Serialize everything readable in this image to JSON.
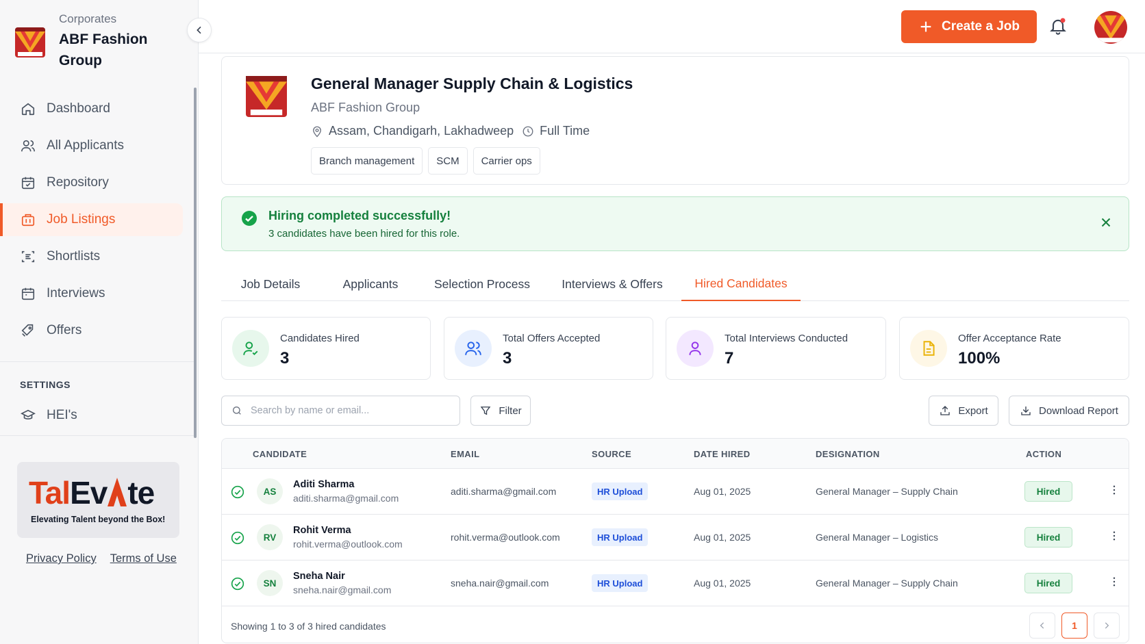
{
  "sidebar": {
    "org_type": "Corporates",
    "org_name": "ABF Fashion Group",
    "nav": [
      {
        "label": "Dashboard",
        "icon": "home-icon"
      },
      {
        "label": "All Applicants",
        "icon": "users-icon"
      },
      {
        "label": "Repository",
        "icon": "calendar-check-icon"
      },
      {
        "label": "Job Listings",
        "icon": "briefcase-icon",
        "active": true
      },
      {
        "label": "Shortlists",
        "icon": "scan-list-icon"
      },
      {
        "label": "Interviews",
        "icon": "calendar-icon"
      },
      {
        "label": "Offers",
        "icon": "tag-icon"
      }
    ],
    "settings_label": "SETTINGS",
    "hei_label": "HEI's",
    "brand": {
      "word_a": "Tal",
      "word_b": "Ev",
      "word_c": "te",
      "tagline": "Elevating Talent beyond the Box!"
    },
    "footer": {
      "privacy": "Privacy Policy",
      "terms": "Terms of Use"
    }
  },
  "topbar": {
    "create_label": "Create a Job"
  },
  "job": {
    "title": "General Manager Supply Chain & Logistics",
    "company": "ABF Fashion Group",
    "locations": "Assam, Chandigarh, Lakhadweep",
    "type": "Full Time",
    "tags": [
      "Branch management",
      "SCM",
      "Carrier ops"
    ]
  },
  "banner": {
    "title": "Hiring completed successfully!",
    "subtitle": "3 candidates have been hired for this role."
  },
  "tabs": [
    "Job Details",
    "Applicants",
    "Selection Process",
    "Interviews & Offers",
    "Hired Candidates"
  ],
  "stats": [
    {
      "label": "Candidates Hired",
      "value": "3"
    },
    {
      "label": "Total Offers Accepted",
      "value": "3"
    },
    {
      "label": "Total Interviews Conducted",
      "value": "7"
    },
    {
      "label": "Offer Acceptance Rate",
      "value": "100%"
    }
  ],
  "toolbar": {
    "search_placeholder": "Search by name or email...",
    "filter_label": "Filter",
    "export_label": "Export",
    "download_label": "Download Report"
  },
  "table": {
    "headers": [
      "CANDIDATE",
      "EMAIL",
      "SOURCE",
      "DATE HIRED",
      "DESIGNATION",
      "ACTION"
    ],
    "rows": [
      {
        "initials": "AS",
        "name": "Aditi Sharma",
        "sub": "aditi.sharma@gmail.com",
        "email": "aditi.sharma@gmail.com",
        "source": "HR Upload",
        "date": "Aug 01, 2025",
        "designation": "General Manager – Supply Chain",
        "status": "Hired"
      },
      {
        "initials": "RV",
        "name": "Rohit Verma",
        "sub": "rohit.verma@outlook.com",
        "email": "rohit.verma@outlook.com",
        "source": "HR Upload",
        "date": "Aug 01, 2025",
        "designation": "General Manager – Logistics",
        "status": "Hired"
      },
      {
        "initials": "SN",
        "name": "Sneha Nair",
        "sub": "sneha.nair@gmail.com",
        "email": "sneha.nair@gmail.com",
        "source": "HR Upload",
        "date": "Aug 01, 2025",
        "designation": "General Manager – Supply Chain",
        "status": "Hired"
      }
    ],
    "footer_text": "Showing 1 to 3 of 3 hired candidates",
    "current_page": "1"
  },
  "colors": {
    "accent": "#f05a28",
    "success": "#15803d",
    "info": "#1d4ed8"
  }
}
